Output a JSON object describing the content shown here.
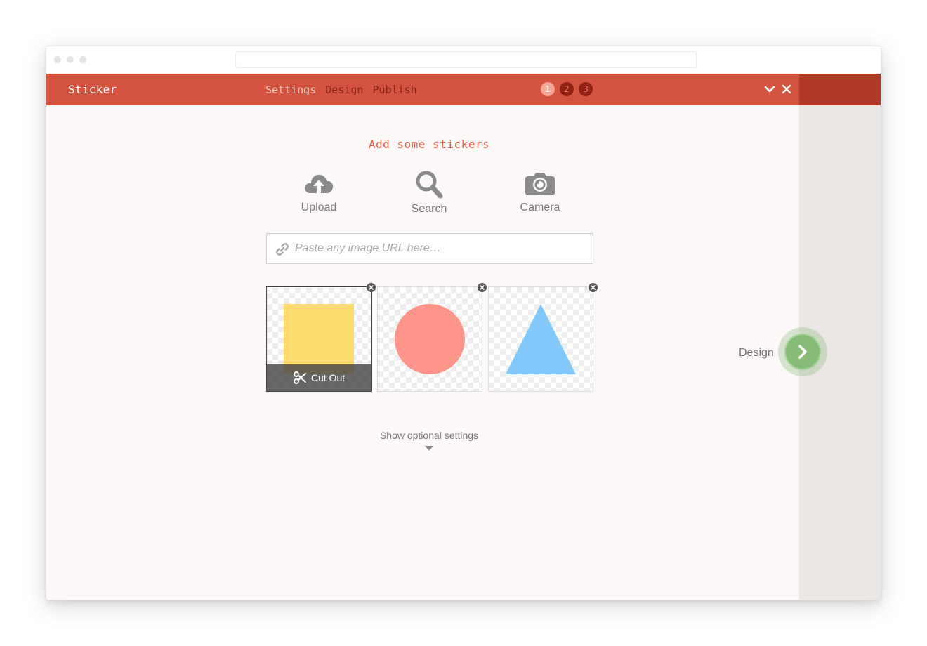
{
  "app": {
    "title": "Sticker",
    "steps": [
      {
        "label": "Settings",
        "active": true
      },
      {
        "label": "Design",
        "active": false
      },
      {
        "label": "Publish",
        "active": false
      }
    ],
    "step_badges": [
      "1",
      "2",
      "3"
    ],
    "collapse_icon": "chevron-down-icon",
    "close_icon": "close-icon"
  },
  "main": {
    "heading": "Add some stickers",
    "sources": [
      {
        "label": "Upload",
        "icon": "cloud-upload-icon"
      },
      {
        "label": "Search",
        "icon": "search-icon"
      },
      {
        "label": "Camera",
        "icon": "camera-icon"
      }
    ],
    "url_input": {
      "placeholder": "Paste any image URL here…",
      "value": "",
      "icon": "link-icon"
    },
    "stickers": [
      {
        "shape": "square",
        "color": "#fcdc6d",
        "selected": true,
        "action_label": "Cut Out"
      },
      {
        "shape": "circle",
        "color": "#fd958a",
        "selected": false
      },
      {
        "shape": "triangle",
        "color": "#83c8fa",
        "selected": false
      }
    ],
    "optional_settings_label": "Show optional settings"
  },
  "next": {
    "label": "Design",
    "icon": "chevron-right-icon",
    "color": "#86bc78"
  },
  "colors": {
    "accent": "#d4533e",
    "accent_dark": "#b03a26",
    "heading": "#e4624b"
  }
}
